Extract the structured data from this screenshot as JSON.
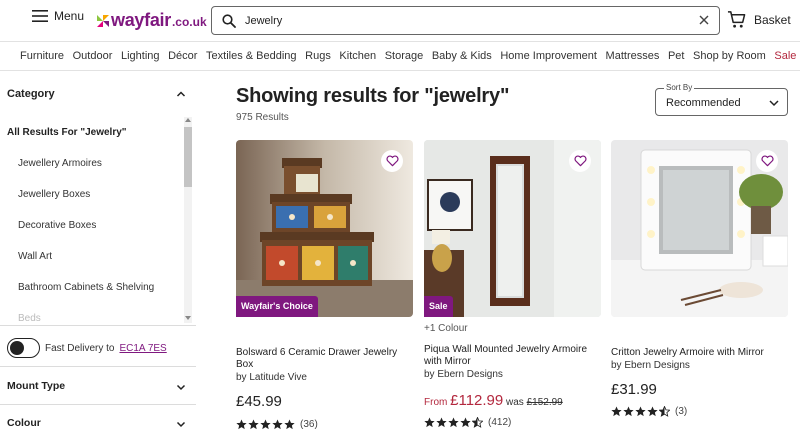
{
  "header": {
    "menu_label": "Menu",
    "logo_text": "wayfair",
    "logo_tld": ".co.uk",
    "search_value": "Jewelry",
    "basket_label": "Basket",
    "brand_color": "#7f187f"
  },
  "nav": {
    "items": [
      "Furniture",
      "Outdoor",
      "Lighting",
      "Décor",
      "Textiles & Bedding",
      "Rugs",
      "Kitchen",
      "Storage",
      "Baby & Kids",
      "Home Improvement",
      "Mattresses",
      "Pet",
      "Shop by Room"
    ],
    "sale_label": "Sale",
    "sale_color": "#b3283e"
  },
  "sidebar": {
    "category_heading": "Category",
    "all_results_label": "All Results For \"Jewelry\"",
    "categories": [
      "Jewellery Armoires",
      "Jewellery Boxes",
      "Decorative Boxes",
      "Wall Art",
      "Bathroom Cabinets & Shelving",
      "Beds"
    ],
    "fast_delivery_label": "Fast Delivery to",
    "postcode": "EC1A 7ES",
    "filters": [
      "Mount Type",
      "Colour"
    ]
  },
  "results": {
    "title": "Showing results for \"jewelry\"",
    "count": "975 Results",
    "sort_label": "Sort By",
    "sort_value": "Recommended"
  },
  "products": [
    {
      "badge": "Wayfair's Choice",
      "name": "Bolsward 6 Ceramic Drawer Jewelry Box",
      "by": "by Latitude Vive",
      "price": "£45.99",
      "rating": 5,
      "reviews": "(36)"
    },
    {
      "badge": "Sale",
      "colour_note": "+1 Colour",
      "name": "Piqua Wall Mounted Jewelry Armoire with Mirror",
      "by": "by Ebern Designs",
      "from_label": "From",
      "sale_price": "£112.99",
      "was_label": "was",
      "was_price": "£152.99",
      "rating": 4.5,
      "reviews": "(412)"
    },
    {
      "name": "Critton Jewelry Armoire with Mirror",
      "by": "by Ebern Designs",
      "price": "£31.99",
      "rating": 4.5,
      "reviews": "(3)"
    }
  ]
}
